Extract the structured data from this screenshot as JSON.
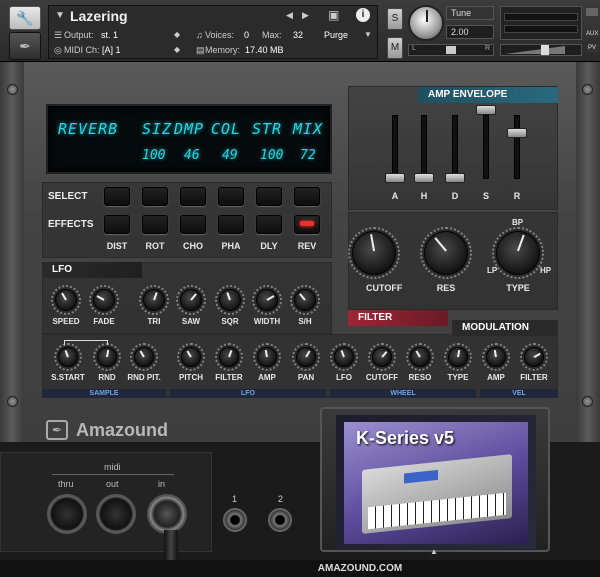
{
  "header": {
    "instrument_name": "Lazering",
    "output_label": "Output:",
    "output_value": "st. 1",
    "midi_label": "MIDI Ch:",
    "midi_value": "[A]  1",
    "voices_label": "Voices:",
    "voices_value": "0",
    "max_label": "Max:",
    "max_value": "32",
    "memory_label": "Memory:",
    "memory_value": "17.40 MB",
    "purge_label": "Purge",
    "s_label": "S",
    "m_label": "M",
    "tune_label": "Tune",
    "tune_value": "2.00",
    "pan_left": "L",
    "pan_right": "R",
    "aux_label": "AUX",
    "pv_label": "PV"
  },
  "display": {
    "labels": [
      "REVERB",
      "SIZ",
      "DMP",
      "COL",
      "STR",
      "MIX"
    ],
    "values": [
      "100",
      "46",
      "49",
      "100",
      "72"
    ]
  },
  "effects": {
    "select_label": "SELECT",
    "effects_label": "EFFECTS",
    "buttons": [
      "DIST",
      "ROT",
      "CHO",
      "PHA",
      "DLY",
      "REV"
    ]
  },
  "amp_envelope": {
    "title": "AMP ENVELOPE",
    "sliders": [
      "A",
      "H",
      "D",
      "S",
      "R"
    ]
  },
  "filter": {
    "title": "FILTER",
    "knobs": [
      "CUTOFF",
      "RES",
      "TYPE"
    ],
    "type_bp": "BP",
    "type_lp": "LP",
    "type_hp": "HP"
  },
  "lfo": {
    "title": "LFO",
    "knobs": [
      "SPEED",
      "FADE",
      "TRI",
      "SAW",
      "SQR",
      "WIDTH",
      "S/H"
    ]
  },
  "modulation": {
    "title": "MODULATION",
    "sample_knobs": [
      "S.START",
      "RND",
      "RND PIT."
    ],
    "lfo_knobs": [
      "PITCH",
      "FILTER",
      "AMP",
      "PAN"
    ],
    "wheel_knobs": [
      "LFO",
      "CUTOFF",
      "RESO",
      "TYPE"
    ],
    "vel_knobs": [
      "AMP",
      "FILTER"
    ],
    "groups": [
      "SAMPLE",
      "LFO",
      "WHEEL",
      "VEL"
    ]
  },
  "brand": {
    "logo_text": "Amazound",
    "cartridge_title": "K-Series v5",
    "footer_url": "AMAZOUND.COM"
  },
  "io": {
    "midi_label": "midi",
    "thru_label": "thru",
    "out_label": "out",
    "in_label": "in",
    "jack1_label": "1",
    "jack2_label": "2"
  },
  "colors": {
    "lcd_text": "#2bd3e6",
    "amp_header": "#2a6a7e",
    "filter_header": "#8a2030",
    "sublabel": "#6ea5e6",
    "led_on": "#ff2a2a"
  }
}
